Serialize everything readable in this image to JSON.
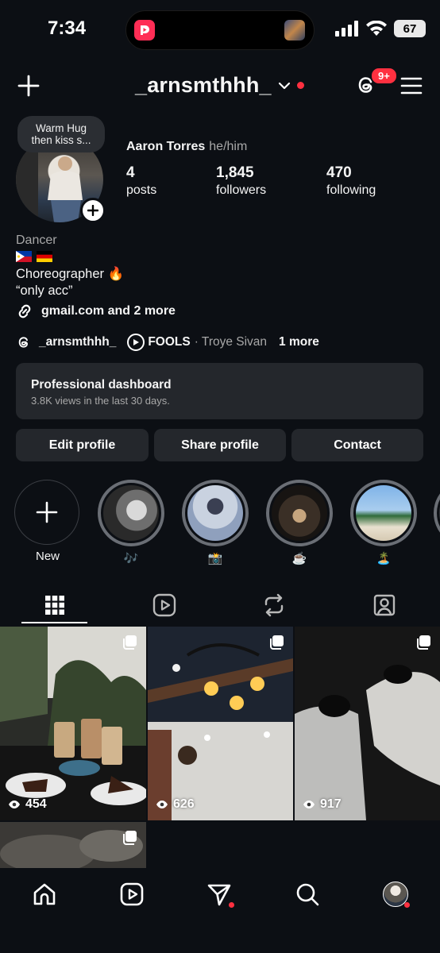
{
  "status_bar": {
    "time": "7:34",
    "battery": "67",
    "icons": [
      "signal-icon",
      "wifi-icon",
      "battery-icon"
    ]
  },
  "header": {
    "username": "_arnsmthhh_",
    "notification_badge": "9+",
    "icons": [
      "plus-icon",
      "chevron-down-icon",
      "threads-icon",
      "menu-icon"
    ]
  },
  "profile": {
    "note_line1": "Warm Hug",
    "note_line2": "then kiss s...",
    "full_name": "Aaron Torres",
    "pronouns": "he/him",
    "stats": [
      {
        "num": "4",
        "label": "posts"
      },
      {
        "num": "1,845",
        "label": "followers"
      },
      {
        "num": "470",
        "label": "following"
      }
    ]
  },
  "bio": {
    "category": "Dancer",
    "flags": [
      "philippines-flag",
      "germany-flag"
    ],
    "line1": "Choreographer 🔥",
    "line2": "“only acc”",
    "link_text": "gmail.com and 2 more",
    "threads_handle": "_arnsmthhh_",
    "song_title": "FOOLS",
    "song_artist": "· Troye Sivan",
    "more_text": "1 more"
  },
  "dashboard": {
    "title": "Professional dashboard",
    "subtitle": "3.8K views in the last 30 days."
  },
  "actions": {
    "edit": "Edit profile",
    "share": "Share profile",
    "contact": "Contact"
  },
  "highlights": [
    {
      "label": "New"
    },
    {
      "label": "🎶"
    },
    {
      "label": "📸"
    },
    {
      "label": "☕️"
    },
    {
      "label": "🏝️"
    }
  ],
  "tabs": [
    "grid-icon",
    "reels-icon",
    "reposts-icon",
    "tagged-icon"
  ],
  "posts": [
    {
      "views": "454",
      "subject": "cafe table with drinks and cake"
    },
    {
      "views": "626",
      "subject": "ceiling lamp with bulbs"
    },
    {
      "views": "917",
      "subject": "dark photo of legs and shoes"
    },
    {
      "views": "",
      "subject": "blurry cafe photo"
    }
  ],
  "bottom_nav": [
    "home-icon",
    "reels-icon",
    "messages-icon",
    "search-icon",
    "profile-avatar"
  ]
}
